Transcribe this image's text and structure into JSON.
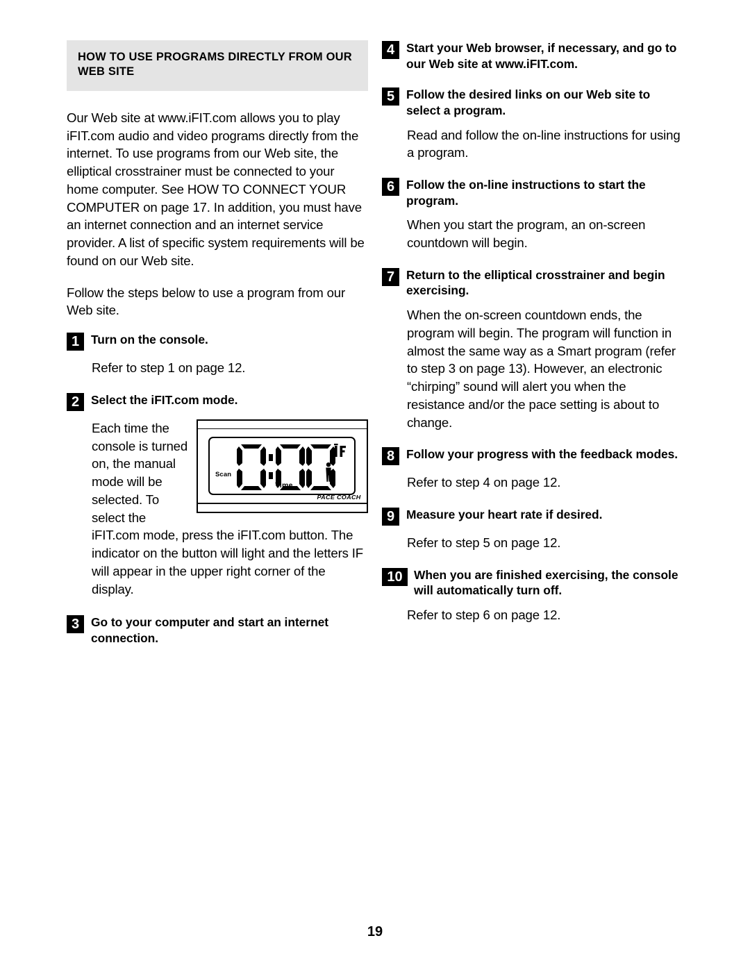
{
  "document": {
    "page_number": "19",
    "header": {
      "title": "HOW TO USE PROGRAMS DIRECTLY FROM OUR WEB SITE",
      "background_color": "#e4e4e4"
    }
  },
  "left_column": {
    "intro_paragraph_1": "Our Web site at www.iFIT.com allows you to play iFIT.com audio and video programs directly from the internet. To use programs from our Web site, the elliptical crosstrainer must be connected to your home computer. See HOW TO CONNECT YOUR COMPUTER on page 17. In addition, you must have an internet connection and an internet service provider. A list of specific system requirements will be found on our Web site.",
    "intro_paragraph_2": "Follow the steps below to use a program from our Web site.",
    "steps": [
      {
        "number": "1",
        "title": "Turn on the console.",
        "body": "Refer to step 1 on page 12."
      },
      {
        "number": "2",
        "title": "Select the iFIT.com mode.",
        "body": "Each time the console is turned on, the manual mode will be selected. To select the iFIT.com mode, press the iFIT.com button. The indicator on the button will light and the letters IF will appear in the upper right corner of the display."
      },
      {
        "number": "3",
        "title": "Go to your computer and start an internet connection.",
        "body": ""
      }
    ],
    "figure": {
      "name": "console-display",
      "lcd_value": "0:00",
      "label_scan": "Scan",
      "label_time": "Time",
      "label_if": "IF",
      "label_pace_coach": "PACE COACH",
      "icon_person": "walking-person-icon"
    }
  },
  "right_column": {
    "steps": [
      {
        "number": "4",
        "title": "Start your Web browser, if necessary, and go to our Web site at www.iFIT.com.",
        "body": ""
      },
      {
        "number": "5",
        "title": "Follow the desired links on our Web site to select a program.",
        "body": "Read and follow the on-line instructions for using a program."
      },
      {
        "number": "6",
        "title": "Follow the on-line instructions to start the program.",
        "body": "When you start the program, an on-screen countdown will begin."
      },
      {
        "number": "7",
        "title": "Return to the elliptical crosstrainer and begin exercising.",
        "body": "When the on-screen countdown ends, the program will begin. The program will function in almost the same way as a Smart program (refer to step 3 on page 13). However, an electronic “chirping” sound will alert you when the resistance and/or the pace setting is about to change."
      },
      {
        "number": "8",
        "title": "Follow your progress with the feedback modes.",
        "body": "Refer to step 4 on page 12."
      },
      {
        "number": "9",
        "title": "Measure your heart rate if desired.",
        "body": "Refer to step 5 on page 12."
      },
      {
        "number": "10",
        "title": "When you are finished exercising, the console will automatically turn off.",
        "body": "Refer to step 6 on page 12."
      }
    ]
  }
}
